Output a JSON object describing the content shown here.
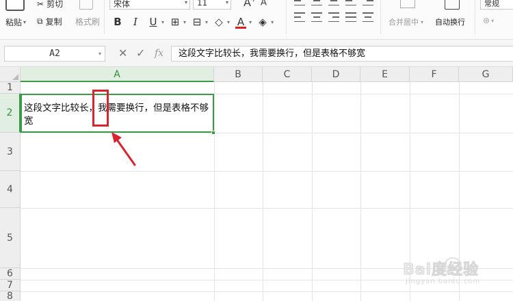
{
  "ribbon": {
    "paste_label": "粘贴",
    "cut_label": "剪切",
    "copy_label": "复制",
    "format_painter_label": "格式刷",
    "font_name": "宋体",
    "font_size": "11",
    "merge_center_label": "合并居中",
    "wrap_text_label": "自动换行",
    "number_format": "常规"
  },
  "formula_bar": {
    "name_box": "A2",
    "fx_label": "fx",
    "formula_value": "这段文字比较长，我需要换行，但是表格不够宽"
  },
  "grid": {
    "columns": [
      "A",
      "B",
      "C",
      "D",
      "E",
      "F",
      "G"
    ],
    "rows": [
      "1",
      "2",
      "3",
      "4",
      "5",
      "6",
      "7",
      "8"
    ],
    "active_column": "A",
    "active_row": "2"
  },
  "cells": {
    "a2": "这段文字比较长，我需要换行，但是表格不够宽"
  },
  "watermark": {
    "brand": "Bai度经验",
    "url": "jingyan.baidu.com"
  },
  "colors": {
    "accent_green": "#3a9a46",
    "annotation_red": "#d9232e"
  }
}
